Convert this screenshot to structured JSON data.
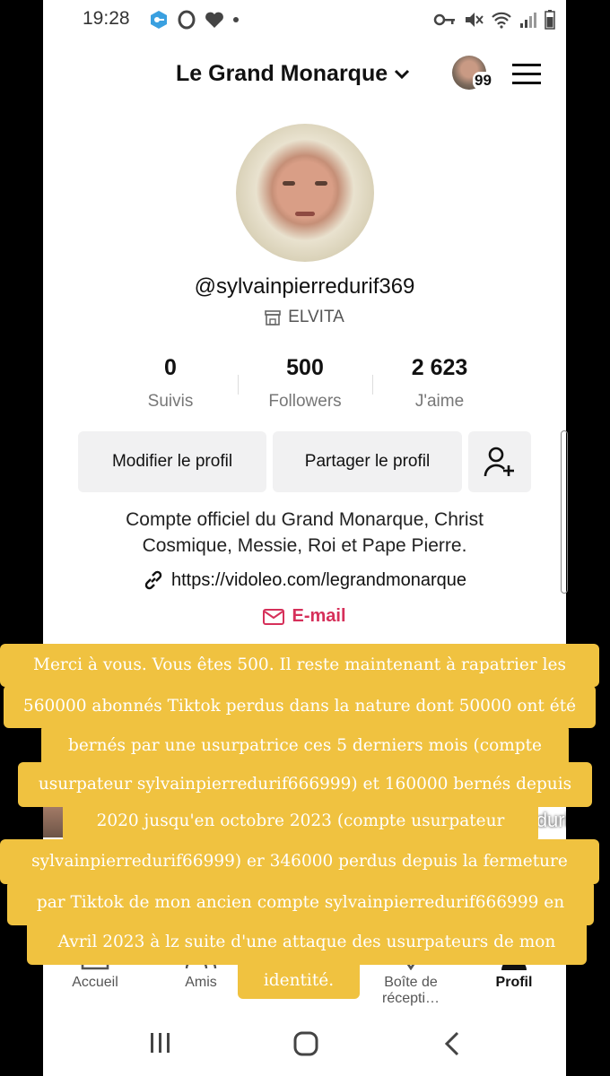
{
  "status_bar": {
    "time": "19:28",
    "icons_left": [
      "vpn-key-icon",
      "opera-icon",
      "heart-icon",
      "dot-icon"
    ],
    "icons_right": [
      "key-icon",
      "mute-icon",
      "wifi-icon",
      "signal-icon",
      "battery-icon"
    ]
  },
  "header": {
    "account_name": "Le Grand Monarque",
    "notification_count": "99"
  },
  "profile": {
    "username": "@sylvainpierredurif369",
    "shop_label": "ELVITA",
    "stats": [
      {
        "value": "0",
        "label": "Suivis"
      },
      {
        "value": "500",
        "label": "Followers"
      },
      {
        "value": "2 623",
        "label": "J'aime"
      }
    ],
    "edit_button": "Modifier le profil",
    "share_button": "Partager le profil",
    "bio_line1": "Compte officiel du Grand Monarque, Christ",
    "bio_line2": "Cosmique, Messie, Roi et Pape Pierre.",
    "link": "https://vidoleo.com/legrandmonarque",
    "email_label": "E-mail"
  },
  "watermark": {
    "handle": "@sylvainpierredurif369"
  },
  "bottom_nav": [
    {
      "label": "Accueil",
      "icon": "home-icon"
    },
    {
      "label": "Amis",
      "icon": "friends-icon"
    },
    {
      "label": "Boîte de récepti…",
      "icon": "inbox-icon"
    },
    {
      "label": "Profil",
      "icon": "profile-icon"
    }
  ],
  "caption": {
    "lines": [
      "Merci à vous. Vous êtes 500. Il reste maintenant à rapatrier les",
      "560000 abonnés Tiktok perdus dans la nature dont 50000 ont été",
      "bernés par une usurpatrice ces 5 derniers mois (compte",
      "usurpateur sylvainpierredurif666999) et 160000 bernés depuis",
      "2020 jusqu'en octobre 2023 (compte usurpateur",
      "sylvainpierredurif66999) er 346000 perdus depuis la fermeture",
      "par Tiktok de mon ancien compte sylvainpierredurif666999 en",
      "Avril 2023 à lz suite d'une attaque  des usurpateurs de mon",
      "identité."
    ]
  },
  "colors": {
    "caption_bg": "#f0c240",
    "email_accent": "#d6305a",
    "button_bg": "#f1f1f2"
  }
}
